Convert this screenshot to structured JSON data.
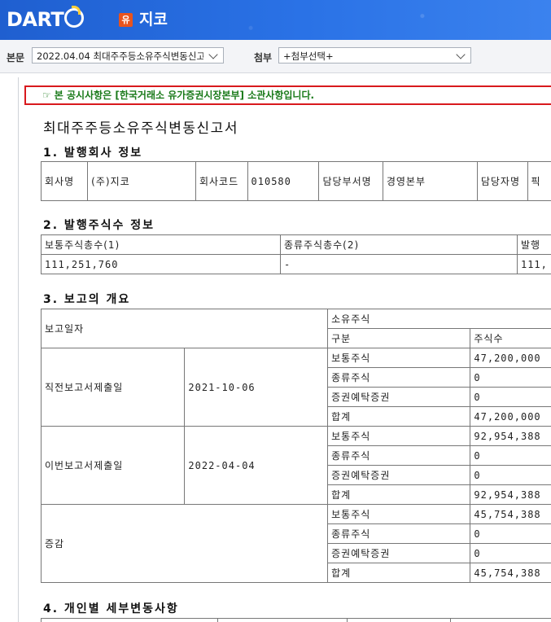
{
  "header": {
    "logo_text": "DART",
    "badge": "유",
    "company": "지코"
  },
  "toolbar": {
    "main_label": "본문",
    "main_value": "2022.04.04  최대주주등소유주식변동신고",
    "attach_label": "첨부",
    "attach_value": "+첨부선택+"
  },
  "notice": "본 공시사항은 [한국거래소 유가증권시장본부] 소관사항입니다.",
  "document": {
    "title": "최대주주등소유주식변동신고서",
    "sec1": {
      "heading": "1. 발행회사 정보",
      "cells": [
        "회사명",
        "(주)지코",
        "회사코드",
        "010580",
        "담당부서명",
        "경영본부",
        "담당자명",
        "픽"
      ]
    },
    "sec2": {
      "heading": "2. 발행주식수 정보",
      "headers": [
        "보통주식총수(1)",
        "종류주식총수(2)",
        "발행"
      ],
      "values": [
        "111,251,760",
        "-",
        "111,"
      ]
    },
    "sec3": {
      "heading": "3. 보고의 개요",
      "report_date": "보고일자",
      "owned": "소유주식",
      "col_type": "구분",
      "col_count": "주식수",
      "groups": [
        {
          "label": "직전보고서제출일",
          "date": "2021-10-06",
          "rows": [
            [
              "보통주식",
              "47,200,000"
            ],
            [
              "종류주식",
              "0"
            ],
            [
              "증권예탁증권",
              "0"
            ],
            [
              "합계",
              "47,200,000"
            ]
          ]
        },
        {
          "label": "이번보고서제출일",
          "date": "2022-04-04",
          "rows": [
            [
              "보통주식",
              "92,954,388"
            ],
            [
              "종류주식",
              "0"
            ],
            [
              "증권예탁증권",
              "0"
            ],
            [
              "합계",
              "92,954,388"
            ]
          ]
        },
        {
          "label": "증감",
          "date": "",
          "rows": [
            [
              "보통주식",
              "45,754,388"
            ],
            [
              "종류주식",
              "0"
            ],
            [
              "증권예탁증권",
              "0"
            ],
            [
              "합계",
              "45,754,388"
            ]
          ]
        }
      ]
    },
    "sec4": {
      "heading": "4. 개인별 세부변동사항"
    }
  }
}
